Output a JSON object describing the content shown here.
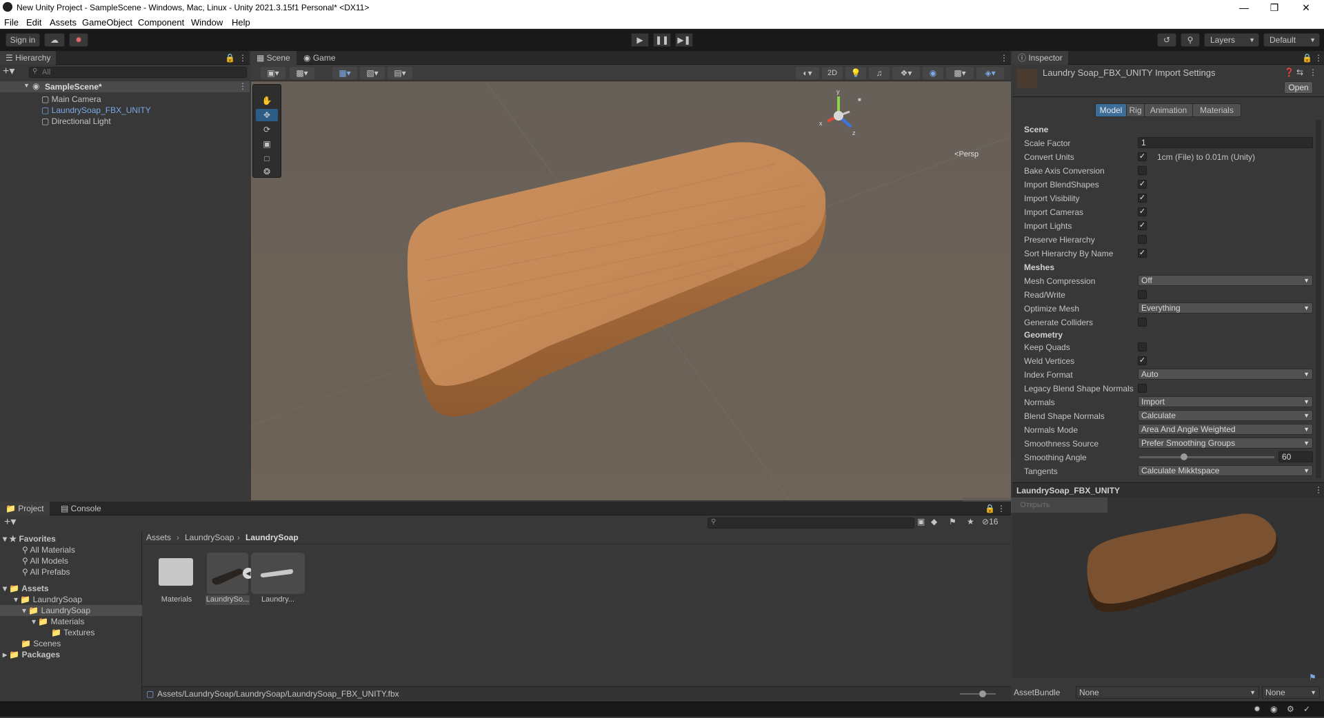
{
  "window": {
    "title": "New Unity Project - SampleScene - Windows, Mac, Linux - Unity 2021.3.15f1 Personal* <DX11>"
  },
  "menu": [
    "File",
    "Edit",
    "Assets",
    "GameObject",
    "Component",
    "Window",
    "Help"
  ],
  "toolbar": {
    "sign_in": "Sign in",
    "layers": "Layers",
    "layout": "Default"
  },
  "hierarchy": {
    "tab": "Hierarchy",
    "search_placeholder": "All",
    "scene": "SampleScene*",
    "items": [
      "Main Camera",
      "LaundrySoap_FBX_UNITY",
      "Directional Light"
    ]
  },
  "scene_view": {
    "tabs": [
      "Scene",
      "Game"
    ],
    "mode_2d": "2D",
    "persp": "Persp",
    "gizmo_axes": {
      "x": "x",
      "y": "y",
      "z": "z"
    }
  },
  "inspector": {
    "tab": "Inspector",
    "title": "Laundry Soap_FBX_UNITY Import Settings",
    "open_button": "Open",
    "tabs": [
      "Model",
      "Rig",
      "Animation",
      "Materials"
    ],
    "active_tab": "Model",
    "sections": {
      "scene": "Scene",
      "meshes": "Meshes",
      "geometry": "Geometry"
    },
    "scale_factor_label": "Scale Factor",
    "scale_factor_value": "1",
    "convert_units_label": "Convert Units",
    "convert_units_note": "1cm (File) to 0.01m (Unity)",
    "toggles": [
      {
        "label": "Bake Axis Conversion",
        "checked": false
      },
      {
        "label": "Import BlendShapes",
        "checked": true
      },
      {
        "label": "Import Visibility",
        "checked": true
      },
      {
        "label": "Import Cameras",
        "checked": true
      },
      {
        "label": "Import Lights",
        "checked": true
      },
      {
        "label": "Preserve Hierarchy",
        "checked": false
      },
      {
        "label": "Sort Hierarchy By Name",
        "checked": true
      }
    ],
    "mesh_compression": {
      "label": "Mesh Compression",
      "value": "Off"
    },
    "read_write": {
      "label": "Read/Write",
      "checked": false
    },
    "optimize_mesh": {
      "label": "Optimize Mesh",
      "value": "Everything"
    },
    "generate_colliders": {
      "label": "Generate Colliders",
      "checked": false
    },
    "keep_quads": {
      "label": "Keep Quads",
      "checked": false
    },
    "weld_vertices": {
      "label": "Weld Vertices",
      "checked": true
    },
    "index_format": {
      "label": "Index Format",
      "value": "Auto"
    },
    "legacy_blend": {
      "label": "Legacy Blend Shape Normals",
      "checked": false
    },
    "normals": {
      "label": "Normals",
      "value": "Import"
    },
    "blend_shape_normals": {
      "label": "Blend Shape Normals",
      "value": "Calculate"
    },
    "normals_mode": {
      "label": "Normals Mode",
      "value": "Area And Angle Weighted"
    },
    "smoothness_source": {
      "label": "Smoothness Source",
      "value": "Prefer Smoothing Groups"
    },
    "smoothing_angle": {
      "label": "Smoothing Angle",
      "value": "60",
      "fraction": 0.33
    },
    "tangents": {
      "label": "Tangents",
      "value": "Calculate Mikktspace"
    },
    "preview_title": "LaundrySoap_FBX_UNITY",
    "assetbundle_label": "AssetBundle",
    "assetbundle_value": "None",
    "assetbundle_variant": "None",
    "ghost_text": "Открыть"
  },
  "project": {
    "tabs": [
      "Project",
      "Console"
    ],
    "hidden_count": "16",
    "favorites_label": "Favorites",
    "favorites": [
      "All Materials",
      "All Models",
      "All Prefabs"
    ],
    "tree": {
      "assets": "Assets",
      "laundry1": "LaundrySoap",
      "laundry2": "LaundrySoap",
      "materials": "Materials",
      "textures": "Textures",
      "scenes": "Scenes",
      "packages": "Packages"
    },
    "breadcrumb": [
      "Assets",
      "LaundrySoap",
      "LaundrySoap"
    ],
    "items": [
      "Materials",
      "LaundrySo...",
      "Laundry..."
    ],
    "path": "Assets/LaundrySoap/LaundrySoap/LaundrySoap_FBX_UNITY.fbx"
  },
  "colors": {
    "selection": "#2c5d87",
    "scene_bg": "#6a6056",
    "soap": "#c48a58",
    "link_blue": "#7ca9e6"
  }
}
